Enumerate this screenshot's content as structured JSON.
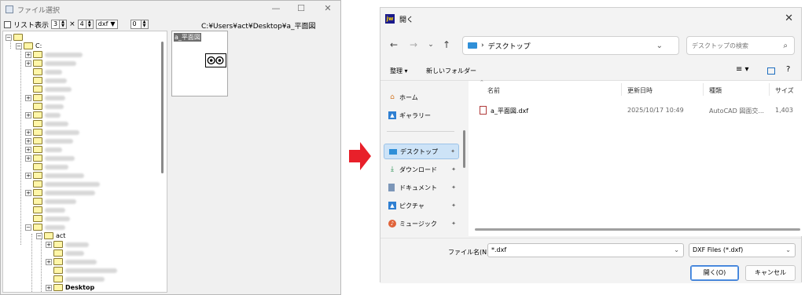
{
  "left_window": {
    "title": "ファイル選択",
    "list_view_label": "リスト表示",
    "columns_value": "3",
    "times_sign": "×",
    "rows_value": "4",
    "extension_value": "dxf",
    "number_value": "0",
    "current_path": "C:¥Users¥act¥Desktop¥a_平面図",
    "tree": {
      "drive": "C:",
      "user_folder": "act",
      "desktop_folder": "Desktop"
    },
    "preview_name": "a_平面図"
  },
  "dialog": {
    "title": "開く",
    "app_badge": "jw",
    "address": "デスクトップ",
    "search_placeholder": "デスクトップの検索",
    "organize_label": "整理 ▾",
    "new_folder_label": "新しいフォルダー",
    "nav_items": [
      {
        "label": "ホーム",
        "icon": "home-icon"
      },
      {
        "label": "ギャラリー",
        "icon": "gallery-icon"
      },
      {
        "label": "デスクトップ",
        "icon": "desktop-icon"
      },
      {
        "label": "ダウンロード",
        "icon": "download-icon"
      },
      {
        "label": "ドキュメント",
        "icon": "document-icon"
      },
      {
        "label": "ピクチャ",
        "icon": "picture-icon"
      },
      {
        "label": "ミュージック",
        "icon": "music-icon"
      }
    ],
    "columns": [
      "名前",
      "更新日時",
      "種類",
      "サイズ"
    ],
    "files": [
      {
        "name": "a_平面図.dxf",
        "modified": "2025/10/17 10:49",
        "type": "AutoCAD 図面交...",
        "size": "1,403"
      }
    ],
    "filename_label": "ファイル名(N):",
    "filename_value": "*.dxf",
    "filetype_value": "DXF Files (*.dxf)",
    "open_button": "開く(O)",
    "cancel_button": "キャンセル"
  },
  "colors": {
    "arrow": "#e8202a",
    "selection": "#cde3f7",
    "folder": "#fff6a8"
  }
}
